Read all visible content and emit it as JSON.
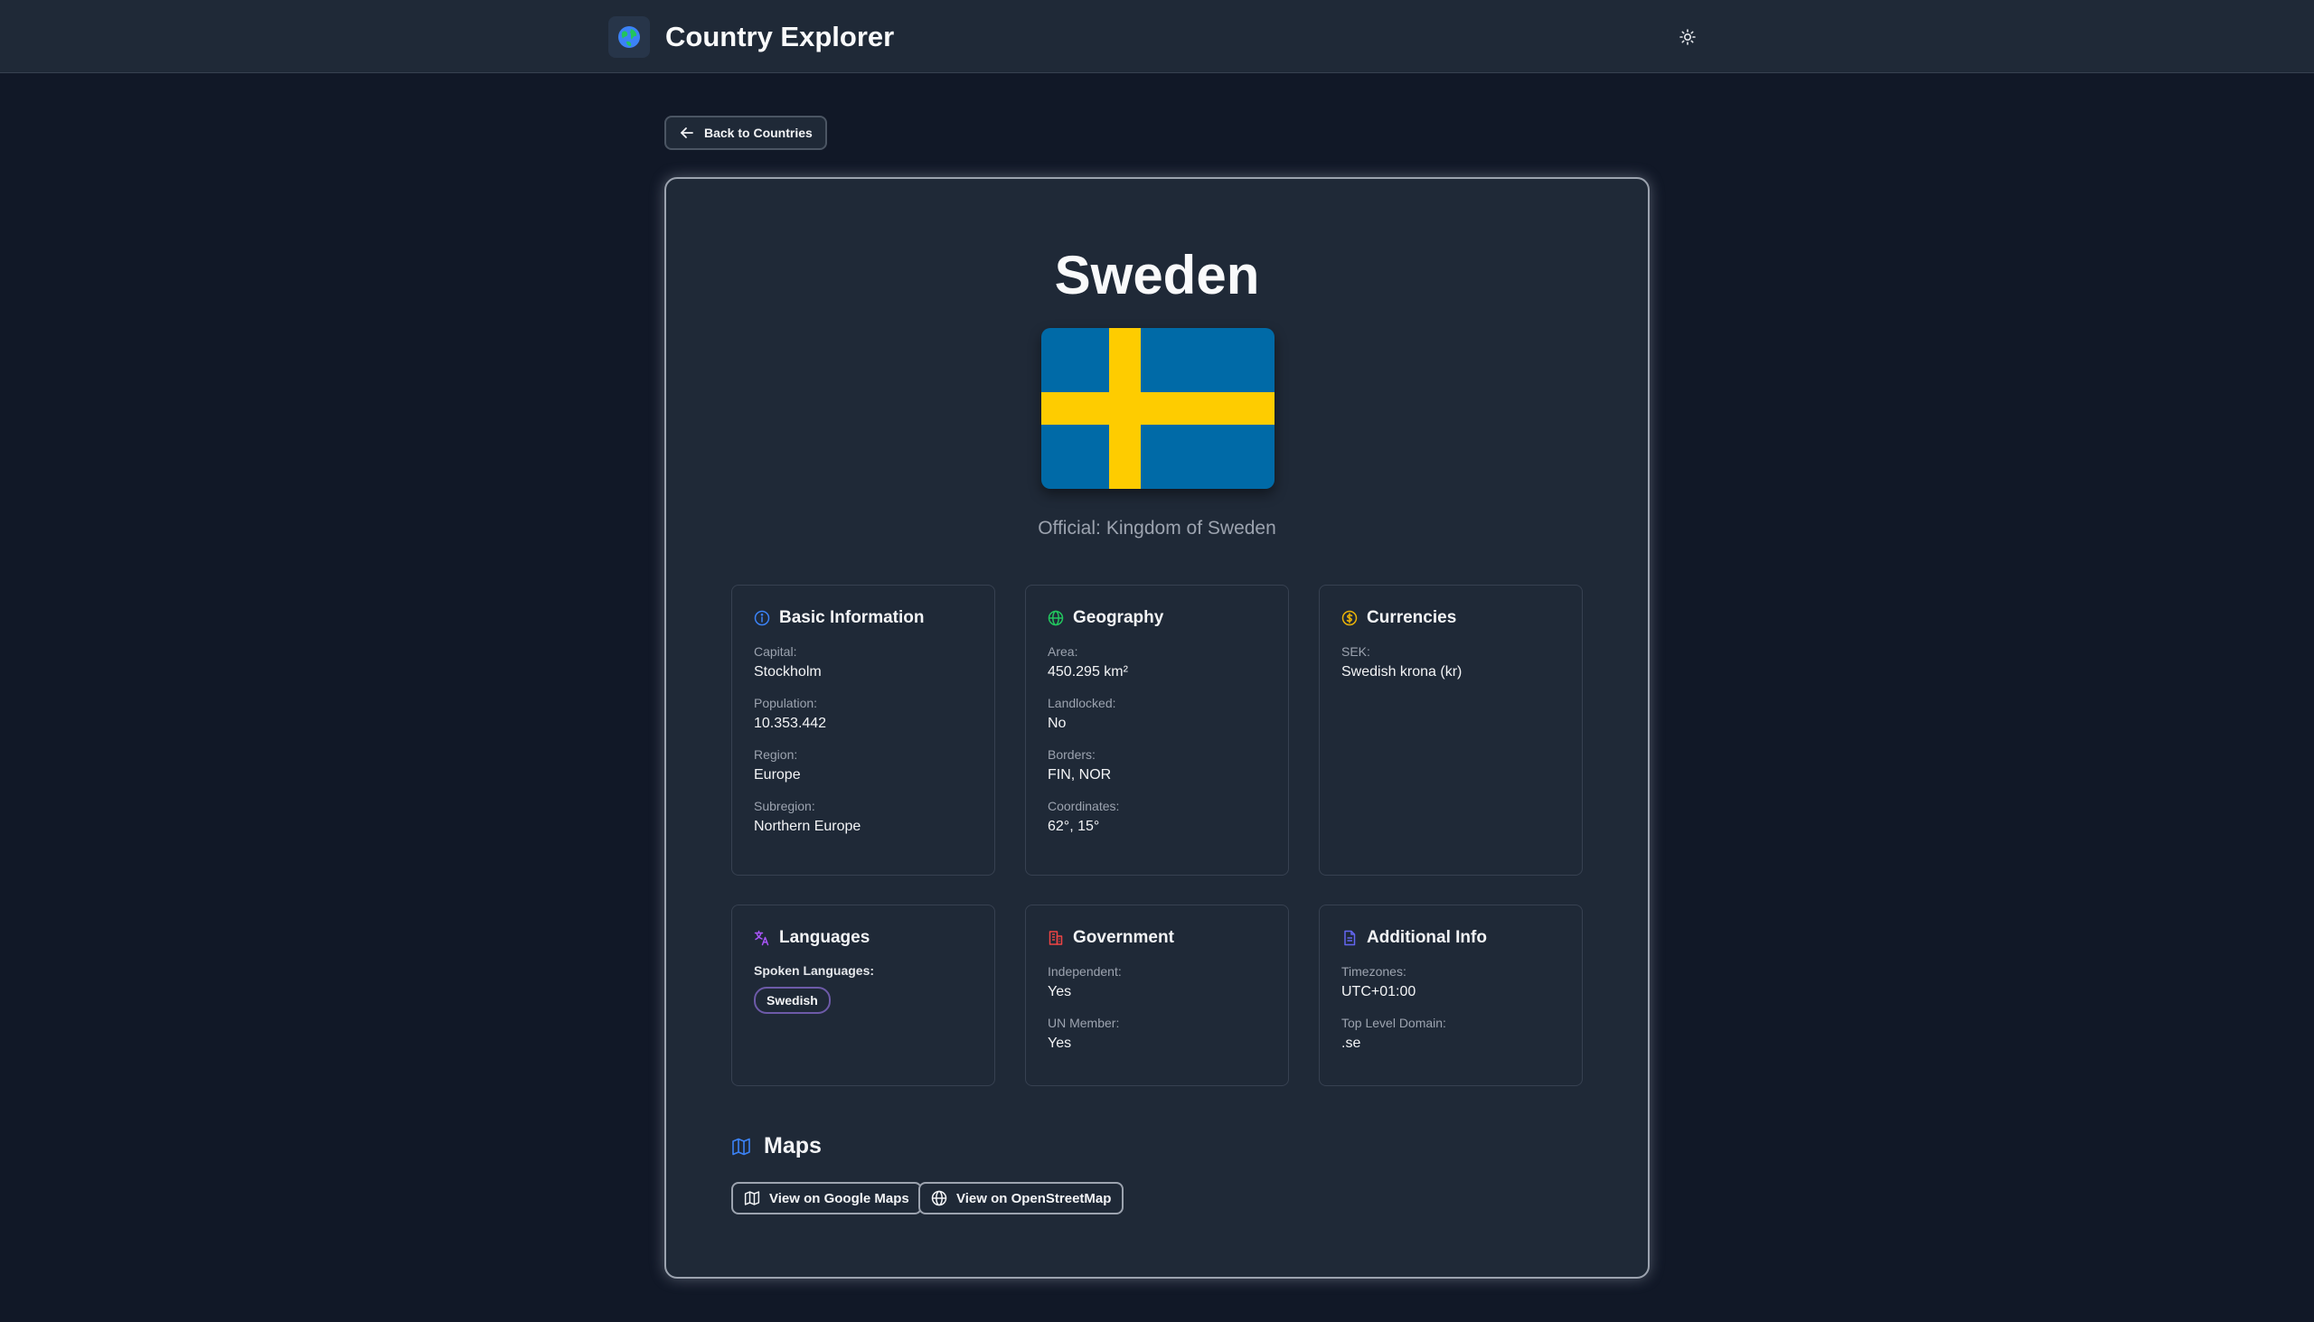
{
  "header": {
    "app_title": "Country Explorer",
    "logo_icon": "globe-icon",
    "theme_icon": "sun-icon"
  },
  "back_button": {
    "label": "Back to Countries",
    "icon": "arrow-left-icon"
  },
  "country": {
    "name": "Sweden",
    "official_prefix": "Official:",
    "official_name": "Kingdom of Sweden",
    "flag_colors": {
      "blue": "#006aa7",
      "yellow": "#fecc00"
    }
  },
  "basic_info": {
    "title": "Basic Information",
    "icon": "info-icon",
    "icon_color": "#3b82f6",
    "fields": [
      {
        "label": "Capital:",
        "value": "Stockholm"
      },
      {
        "label": "Population:",
        "value": "10.353.442"
      },
      {
        "label": "Region:",
        "value": "Europe"
      },
      {
        "label": "Subregion:",
        "value": "Northern Europe"
      }
    ]
  },
  "geography": {
    "title": "Geography",
    "icon": "globe-icon",
    "icon_color": "#22c55e",
    "fields": [
      {
        "label": "Area:",
        "value": "450.295 km²"
      },
      {
        "label": "Landlocked:",
        "value": "No"
      },
      {
        "label": "Borders:",
        "value": "FIN, NOR"
      },
      {
        "label": "Coordinates:",
        "value": "62°, 15°"
      }
    ]
  },
  "currencies": {
    "title": "Currencies",
    "icon": "dollar-circle-icon",
    "icon_color": "#eab308",
    "fields": [
      {
        "label": "SEK:",
        "value": "Swedish krona (kr)"
      }
    ]
  },
  "languages": {
    "title": "Languages",
    "icon": "translate-icon",
    "icon_color": "#a855f7",
    "sub_heading": "Spoken Languages:",
    "items": [
      "Swedish"
    ]
  },
  "government": {
    "title": "Government",
    "icon": "building-icon",
    "icon_color": "#ef4444",
    "fields": [
      {
        "label": "Independent:",
        "value": "Yes"
      },
      {
        "label": "UN Member:",
        "value": "Yes"
      }
    ]
  },
  "additional_info": {
    "title": "Additional Info",
    "icon": "document-icon",
    "icon_color": "#6366f1",
    "fields": [
      {
        "label": "Timezones:",
        "value": "UTC+01:00"
      },
      {
        "label": "Top Level Domain:",
        "value": ".se"
      }
    ]
  },
  "maps": {
    "title": "Maps",
    "icon": "map-icon",
    "icon_color": "#3b82f6",
    "google_label": "View on Google Maps",
    "osm_label": "View on OpenStreetMap"
  }
}
